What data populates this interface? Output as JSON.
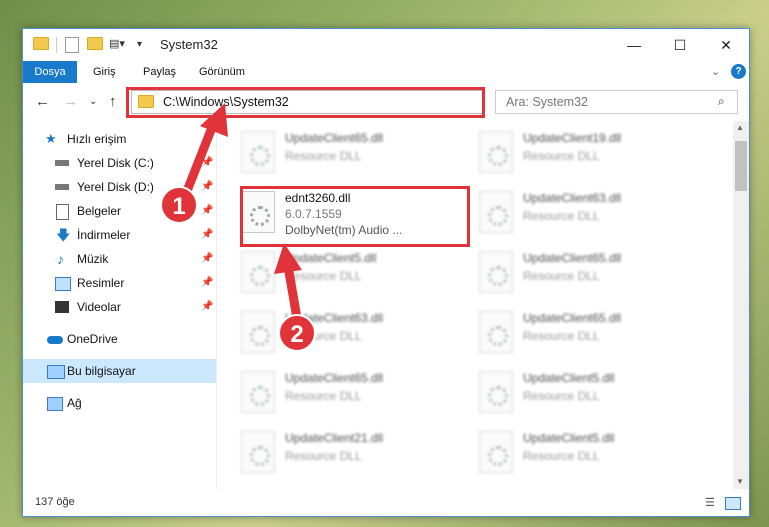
{
  "window": {
    "title": "System32",
    "minimize": "—",
    "maximize": "☐",
    "close": "✕"
  },
  "ribbon": {
    "tabs": [
      "Dosya",
      "Giriş",
      "Paylaş",
      "Görünüm"
    ],
    "collapse": "⌄",
    "help": "?"
  },
  "address": {
    "path": "C:\\Windows\\System32",
    "search_placeholder": "Ara: System32"
  },
  "sidebar": {
    "items": [
      {
        "label": "Hızlı erişim"
      },
      {
        "label": "Yerel Disk (C:)"
      },
      {
        "label": "Yerel Disk (D:)"
      },
      {
        "label": "Belgeler"
      },
      {
        "label": "İndirmeler"
      },
      {
        "label": "Müzik"
      },
      {
        "label": "Resimler"
      },
      {
        "label": "Videolar"
      },
      {
        "label": "OneDrive"
      },
      {
        "label": "Bu bilgisayar"
      },
      {
        "label": "Ağ"
      }
    ]
  },
  "files": {
    "highlighted": {
      "name": "ednt3260.dll",
      "version": "6.0.7.1559",
      "desc": "DolbyNet(tm) Audio ..."
    },
    "blurred": [
      {
        "name": "UpdateClient65.dll",
        "type": "Resource DLL"
      },
      {
        "name": "UpdateClient19.dll",
        "type": "Resource DLL"
      },
      {
        "name": "UpdateClient63.dll",
        "type": "Resource DLL"
      },
      {
        "name": "UpdateClient5.dll",
        "type": "Resource DLL"
      },
      {
        "name": "UpdateClient65.dll",
        "type": "Resource DLL"
      },
      {
        "name": "UpdateClient63.dll",
        "type": "Resource DLL"
      },
      {
        "name": "UpdateClient65.dll",
        "type": "Resource DLL"
      },
      {
        "name": "UpdateClient65.dll",
        "type": "Resource DLL"
      },
      {
        "name": "UpdateClient5.dll",
        "type": "Resource DLL"
      },
      {
        "name": "UpdateClient21.dll",
        "type": "Resource DLL"
      },
      {
        "name": "UpdateClient5.dll",
        "type": "Resource DLL"
      }
    ]
  },
  "status": {
    "count": "137 öğe"
  },
  "annotations": {
    "badge1": "1",
    "badge2": "2",
    "color": "#e0343a"
  }
}
